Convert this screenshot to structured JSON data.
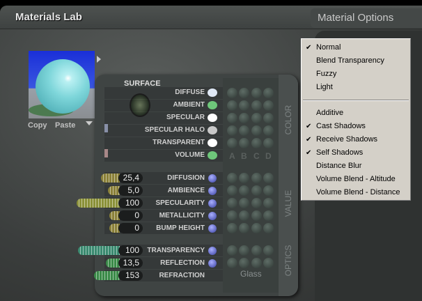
{
  "window": {
    "title": "Materials Lab",
    "options_header": "Material Options"
  },
  "preview": {
    "copy": "Copy",
    "paste": "Paste"
  },
  "surface": {
    "label": "SURFACE",
    "color_section": "COLOR",
    "value_section": "VALUE",
    "optics_section": "OPTICS",
    "columns": [
      "A",
      "B",
      "C",
      "D"
    ],
    "colors": [
      {
        "label": "DIFFUSE",
        "color": "#dfe8f5"
      },
      {
        "label": "AMBIENT",
        "color": "#6ec77a"
      },
      {
        "label": "SPECULAR",
        "color": "#ffffff"
      },
      {
        "label": "SPECULAR HALO",
        "color": "#c8c8c8"
      },
      {
        "label": "TRANSPARENT",
        "color": "#ffffff"
      },
      {
        "label": "VOLUME",
        "color": "#6ec77a"
      }
    ],
    "values": [
      {
        "label": "DIFFUSION",
        "value": "25,4"
      },
      {
        "label": "AMBIENCE",
        "value": "5,0"
      },
      {
        "label": "SPECULARITY",
        "value": "100"
      },
      {
        "label": "METALLICITY",
        "value": "0"
      },
      {
        "label": "BUMP HEIGHT",
        "value": "0"
      }
    ],
    "optics": [
      {
        "label": "TRANSPARENCY",
        "value": "100"
      },
      {
        "label": "REFLECTION",
        "value": "13,5"
      },
      {
        "label": "REFRACTION",
        "value": "153"
      }
    ],
    "optics_preset": "Glass"
  },
  "menu": {
    "items": [
      {
        "label": "Normal",
        "checked": true
      },
      {
        "label": "Blend Transparency",
        "checked": false
      },
      {
        "label": "Fuzzy",
        "checked": false
      },
      {
        "label": "Light",
        "checked": false
      },
      {
        "label": "Additive",
        "checked": false
      },
      {
        "label": "Cast Shadows",
        "checked": true
      },
      {
        "label": "Receive Shadows",
        "checked": true
      },
      {
        "label": "Self Shadows",
        "checked": true
      },
      {
        "label": "Distance Blur",
        "checked": false
      },
      {
        "label": "Volume Blend - Altitude",
        "checked": false
      },
      {
        "label": "Volume Blend - Distance",
        "checked": false
      }
    ],
    "check_glyph": "✔"
  }
}
